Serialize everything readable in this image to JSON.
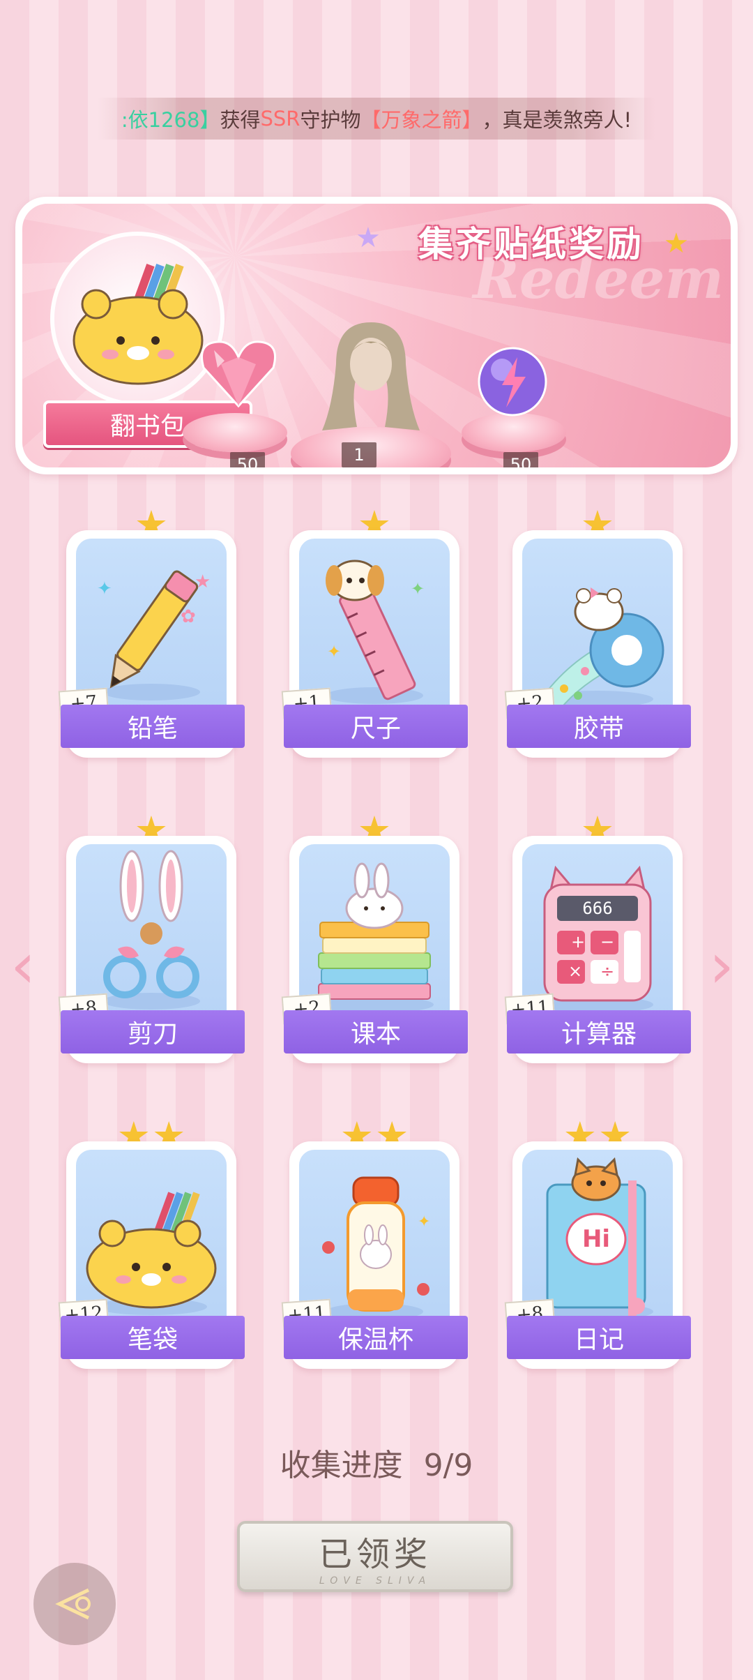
{
  "ticker": {
    "prefix": ":依1268】",
    "text_a": "获得",
    "rarity": "SSR",
    "text_b": "守护物",
    "item": "【万象之箭】",
    "text_c": "，真是羡煞旁人!"
  },
  "banner": {
    "title": "集齐贴纸奖励",
    "watermark": "Redeem",
    "bag_button": "翻书包",
    "rewards": [
      {
        "name": "heart-gem",
        "qty": "50"
      },
      {
        "name": "hairstyle",
        "qty": "1"
      },
      {
        "name": "energy-orb",
        "qty": "50"
      }
    ]
  },
  "cards": [
    {
      "label": "铅笔",
      "count": "+7",
      "stars": 1,
      "icon": "pencil"
    },
    {
      "label": "尺子",
      "count": "+1",
      "stars": 1,
      "icon": "ruler"
    },
    {
      "label": "胶带",
      "count": "+2",
      "stars": 1,
      "icon": "tape"
    },
    {
      "label": "剪刀",
      "count": "+8",
      "stars": 1,
      "icon": "scissors"
    },
    {
      "label": "课本",
      "count": "+2",
      "stars": 1,
      "icon": "textbook"
    },
    {
      "label": "计算器",
      "count": "+11",
      "stars": 1,
      "icon": "calculator",
      "display": "666"
    },
    {
      "label": "笔袋",
      "count": "+12",
      "stars": 2,
      "icon": "pencil-case"
    },
    {
      "label": "保温杯",
      "count": "+11",
      "stars": 2,
      "icon": "thermos"
    },
    {
      "label": "日记",
      "count": "+8",
      "stars": 2,
      "icon": "diary",
      "cover": "Hi"
    }
  ],
  "progress": {
    "label": "收集进度",
    "value": "9/9"
  },
  "claim_button": {
    "label": "已领奖",
    "sub": "LOVE SLIVA"
  },
  "colors": {
    "accent_purple": "#9a6cec",
    "accent_pink": "#e5557f",
    "star_gold": "#f7c232"
  }
}
